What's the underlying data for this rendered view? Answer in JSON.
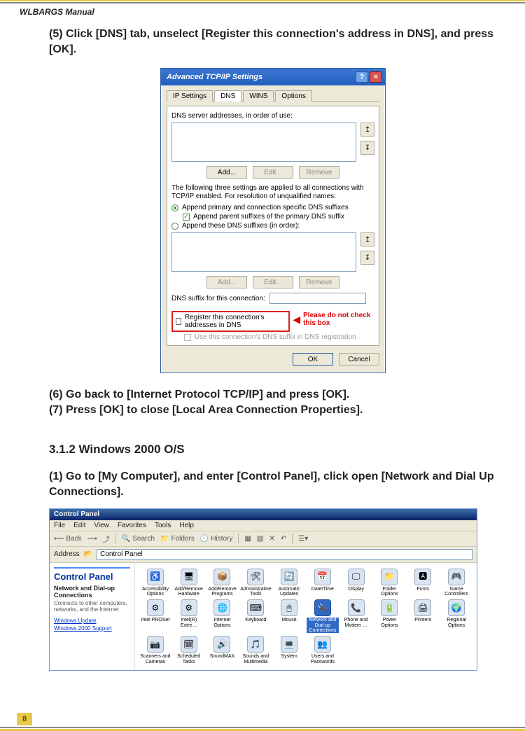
{
  "header": {
    "title": "WLBARGS Manual"
  },
  "page": {
    "number": "8"
  },
  "steps": {
    "s5": "(5) Click [DNS] tab, unselect [Register this connection's address in DNS], and press [OK].",
    "s6": "(6) Go back to [Internet Protocol TCP/IP] and press [OK].",
    "s7": "(7) Press [OK] to close [Local Area Connection Properties].",
    "section": "3.1.2 Windows 2000 O/S",
    "w1": "(1) Go to [My Computer], and enter [Control Panel], click open [Network and Dial Up Connections]."
  },
  "xp": {
    "title": "Advanced TCP/IP Settings",
    "tabs": {
      "ip": "IP Settings",
      "dns": "DNS",
      "wins": "WINS",
      "opt": "Options"
    },
    "dns_label": "DNS server addresses, in order of use:",
    "add": "Add...",
    "edit": "Edit...",
    "remove": "Remove",
    "note": "The following three settings are applied to all connections with TCP/IP enabled. For resolution of unqualified names:",
    "r1": "Append primary and connection specific DNS suffixes",
    "c1": "Append parent suffixes of the primary DNS suffix",
    "r2": "Append these DNS suffixes (in order):",
    "suffix_label": "DNS suffix for this connection:",
    "reg": "Register this connection's addresses in DNS",
    "usesuf": "Use this connection's DNS suffix in DNS registration",
    "callout": "Please do not check this box",
    "ok": "OK",
    "cancel": "Cancel"
  },
  "cp": {
    "title": "Control Panel",
    "menu": {
      "file": "File",
      "edit": "Edit",
      "view": "View",
      "fav": "Favorites",
      "tools": "Tools",
      "help": "Help"
    },
    "tb": {
      "back": "Back",
      "search": "Search",
      "folders": "Folders",
      "history": "History"
    },
    "addr_label": "Address",
    "addr_value": "Control Panel",
    "side": {
      "title": "Control Panel",
      "sub": "Network and Dial-up Connections",
      "desc": "Connects to other computers, networks, and the Internet",
      "link1": "Windows Update",
      "link2": "Windows 2000 Support"
    },
    "icons": [
      {
        "g": "♿",
        "l": "Accessibility Options"
      },
      {
        "g": "🖥",
        "l": "Add/Remove Hardware"
      },
      {
        "g": "📦",
        "l": "Add/Remove Programs"
      },
      {
        "g": "🛠",
        "l": "Administrative Tools"
      },
      {
        "g": "🔄",
        "l": "Automatic Updates"
      },
      {
        "g": "📅",
        "l": "Date/Time"
      },
      {
        "g": "🖵",
        "l": "Display"
      },
      {
        "g": "📁",
        "l": "Folder Options"
      },
      {
        "g": "🅰",
        "l": "Fonts"
      },
      {
        "g": "🎮",
        "l": "Game Controllers"
      },
      {
        "g": "⚙",
        "l": "Intel PROSet"
      },
      {
        "g": "⚙",
        "l": "Intel(R) Extre…"
      },
      {
        "g": "🌐",
        "l": "Internet Options"
      },
      {
        "g": "⌨",
        "l": "Keyboard"
      },
      {
        "g": "🖱",
        "l": "Mouse"
      },
      {
        "g": "🔌",
        "l": "Network and Dial-up Connections",
        "sel": true
      },
      {
        "g": "📞",
        "l": "Phone and Modem …"
      },
      {
        "g": "🔋",
        "l": "Power Options"
      },
      {
        "g": "🖨",
        "l": "Printers"
      },
      {
        "g": "🌍",
        "l": "Regional Options"
      },
      {
        "g": "📷",
        "l": "Scanners and Cameras"
      },
      {
        "g": "🗓",
        "l": "Scheduled Tasks"
      },
      {
        "g": "🔊",
        "l": "SoundMAX"
      },
      {
        "g": "🎵",
        "l": "Sounds and Multimedia"
      },
      {
        "g": "💻",
        "l": "System"
      },
      {
        "g": "👥",
        "l": "Users and Passwords"
      }
    ]
  }
}
